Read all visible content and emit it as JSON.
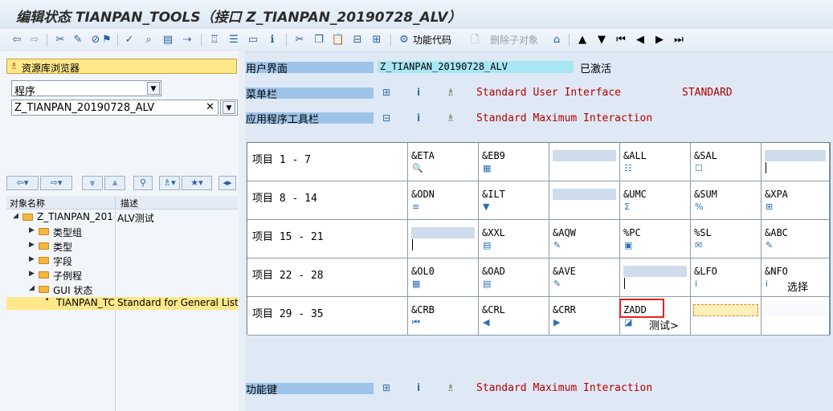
{
  "title": "编辑状态 TIANPAN_TOOLS（接口 Z_TIANPAN_20190728_ALV）",
  "toolbar": {
    "function_code_label": "功能代码",
    "delete_subobject_label": "删除子对象"
  },
  "left": {
    "repo_browser_label": "资源库浏览器",
    "object_type_value": "程序",
    "object_name_value": "Z_TIANPAN_20190728_ALV",
    "tree_headers": {
      "name": "对象名称",
      "desc": "描述"
    },
    "tree": [
      {
        "name": "Z_TIANPAN_201",
        "desc": "ALV测试"
      },
      {
        "name": "类型组",
        "desc": ""
      },
      {
        "name": "类型",
        "desc": ""
      },
      {
        "name": "字段",
        "desc": ""
      },
      {
        "name": "子例程",
        "desc": ""
      },
      {
        "name": "GUI 状态",
        "desc": ""
      },
      {
        "name": "TIANPAN_TC",
        "desc": "Standard for General List Ou"
      }
    ]
  },
  "right": {
    "user_interface": {
      "label": "用户界面",
      "value": "Z_TIANPAN_20190728_ALV",
      "status": "已激活"
    },
    "menu_bar": {
      "label": "菜单栏",
      "text": "Standard User Interface",
      "code": "STANDARD"
    },
    "app_toolbar": {
      "label": "应用程序工具栏",
      "text": "Standard Maximum Interaction"
    },
    "function_keys": {
      "label": "功能键",
      "text": "Standard Maximum Interaction"
    },
    "rows": [
      {
        "label": "项目  1 -  7",
        "items": [
          {
            "code": "&ETA",
            "icon": "magnifier-icon",
            "glyph": "🔍"
          },
          {
            "code": "&EB9",
            "icon": "grid-icon",
            "glyph": "▦"
          },
          {
            "code": "",
            "blank": true
          },
          {
            "code": "&ALL",
            "icon": "select-all-icon",
            "glyph": "☷"
          },
          {
            "code": "&SAL",
            "icon": "deselect-all-icon",
            "glyph": "☐"
          },
          {
            "code": "",
            "blank": true,
            "tick": true
          }
        ]
      },
      {
        "label": "项目  8 - 14",
        "items": [
          {
            "code": "&ODN",
            "icon": "sort-icon",
            "glyph": "≡"
          },
          {
            "code": "&ILT",
            "icon": "filter-icon",
            "glyph": "▼"
          },
          {
            "code": "",
            "blank": true
          },
          {
            "code": "&UMC",
            "icon": "sum-icon",
            "glyph": "Σ"
          },
          {
            "code": "&SUM",
            "icon": "subtotal-icon",
            "glyph": "%"
          },
          {
            "code": "&XPA",
            "icon": "expand-icon",
            "glyph": "⊞"
          }
        ]
      },
      {
        "label": "项目 15 - 21",
        "items": [
          {
            "code": "",
            "blank": true,
            "tick": true
          },
          {
            "code": "&XXL",
            "icon": "excel-icon",
            "glyph": "▤"
          },
          {
            "code": "&AQW",
            "icon": "word-icon",
            "glyph": "✎"
          },
          {
            "code": "%PC",
            "icon": "save-local-icon",
            "glyph": "▣"
          },
          {
            "code": "%SL",
            "icon": "mail-icon",
            "glyph": "✉"
          },
          {
            "code": "&ABC",
            "icon": "abc-icon",
            "glyph": "✎"
          }
        ]
      },
      {
        "label": "项目 22 - 28",
        "items": [
          {
            "code": "&OL0",
            "icon": "layout-icon",
            "glyph": "▦"
          },
          {
            "code": "&OAD",
            "icon": "choose-layout-icon",
            "glyph": "▤"
          },
          {
            "code": "&AVE",
            "icon": "save-layout-icon",
            "glyph": "✎"
          },
          {
            "code": "",
            "blank": true,
            "tick": true
          },
          {
            "code": "&LFO",
            "icon": "info-icon",
            "glyph": "i"
          },
          {
            "code": "&NFO",
            "icon": "info-icon",
            "glyph": "i",
            "extra": "选择"
          }
        ]
      },
      {
        "label": "项目 29 - 35",
        "items": [
          {
            "code": "&CRB",
            "icon": "first-page-icon",
            "glyph": "⏮"
          },
          {
            "code": "&CRL",
            "icon": "previous-page-icon",
            "glyph": "◀"
          },
          {
            "code": "&CRR",
            "icon": "next-page-icon",
            "glyph": "▶"
          },
          {
            "code": "ZADD",
            "icon": "test-icon",
            "glyph": "◪",
            "extra": "测试>"
          },
          {
            "code": "",
            "input": true
          },
          {
            "code": "",
            "empty": true
          }
        ]
      }
    ]
  }
}
